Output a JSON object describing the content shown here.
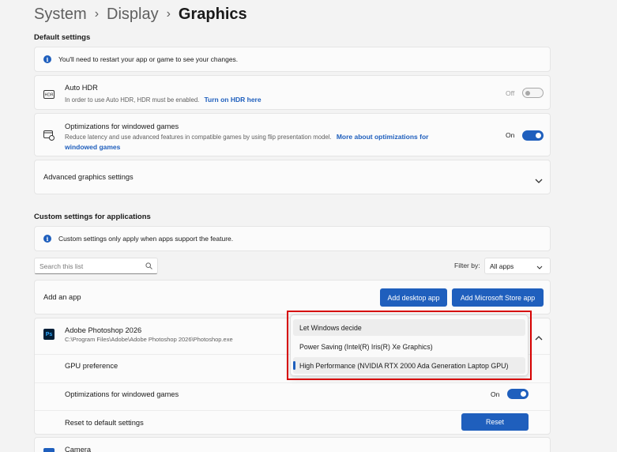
{
  "breadcrumb": {
    "level1": "System",
    "level2": "Display",
    "current": "Graphics",
    "separator": "›"
  },
  "default_settings": {
    "heading": "Default settings",
    "restart_notice": "You'll need to restart your app or game to see your changes.",
    "auto_hdr": {
      "title": "Auto HDR",
      "desc": "In order to use Auto HDR, HDR must be enabled.",
      "link": "Turn on HDR here",
      "state": "Off"
    },
    "windowed": {
      "title": "Optimizations for windowed games",
      "desc": "Reduce latency and use advanced features in compatible games by using flip presentation model.",
      "link_line1": "More about optimizations for",
      "link_line2": "windowed games",
      "state": "On"
    },
    "advanced": {
      "title": "Advanced graphics settings"
    }
  },
  "custom_settings": {
    "heading": "Custom settings for applications",
    "notice": "Custom settings only apply when apps support the feature.",
    "search_placeholder": "Search this list",
    "filter_label": "Filter by:",
    "filter_value": "All apps",
    "add_app": {
      "label": "Add an app",
      "desktop_button": "Add desktop app",
      "store_button": "Add Microsoft Store app"
    }
  },
  "app": {
    "name": "Adobe Photoshop 2026",
    "path": "C:\\Program Files\\Adobe\\Adobe Photoshop 2026\\Photoshop.exe",
    "icon_text": "Ps",
    "gpu_label": "GPU preference",
    "windowed_label": "Optimizations for windowed games",
    "windowed_state": "On",
    "reset_label": "Reset to default settings",
    "reset_button": "Reset"
  },
  "gpu_menu": {
    "options": [
      "Let Windows decide",
      "Power Saving (Intel(R) Iris(R) Xe Graphics)",
      "High Performance (NVIDIA RTX 2000 Ada Generation Laptop GPU)"
    ],
    "selected_index": 2
  },
  "next_app": {
    "name": "Camera"
  },
  "colors": {
    "accent": "#1f5fbd",
    "highlight": "#d60000",
    "background": "#f3f3f3"
  }
}
